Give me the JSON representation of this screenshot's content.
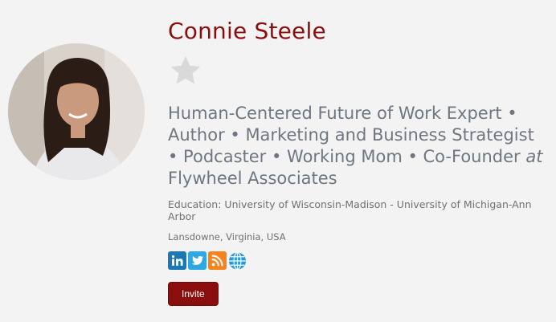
{
  "profile": {
    "name": "Connie Steele",
    "headline_prefix": "Human-Centered Future of Work Expert • Author • Marketing and Business Strategist • Podcaster • Working Mom • Co-Founder ",
    "headline_at": "at",
    "headline_company": " Flywheel Associates",
    "education": "Education: University of Wisconsin-Madison - University of Michigan-Ann Arbor",
    "location": "Lansdowne, Virginia, USA"
  },
  "socials": [
    {
      "icon": "linkedin-icon",
      "color": "#1b78b5"
    },
    {
      "icon": "twitter-icon",
      "color": "#2fa7e3"
    },
    {
      "icon": "rss-icon",
      "color": "#f5841f"
    },
    {
      "icon": "globe-icon",
      "color": "#2a9ad6"
    }
  ],
  "actions": {
    "invite_label": "Invite"
  },
  "colors": {
    "accent": "#8b0e0e",
    "headline": "#6e7680",
    "background": "#f3f3f3"
  }
}
